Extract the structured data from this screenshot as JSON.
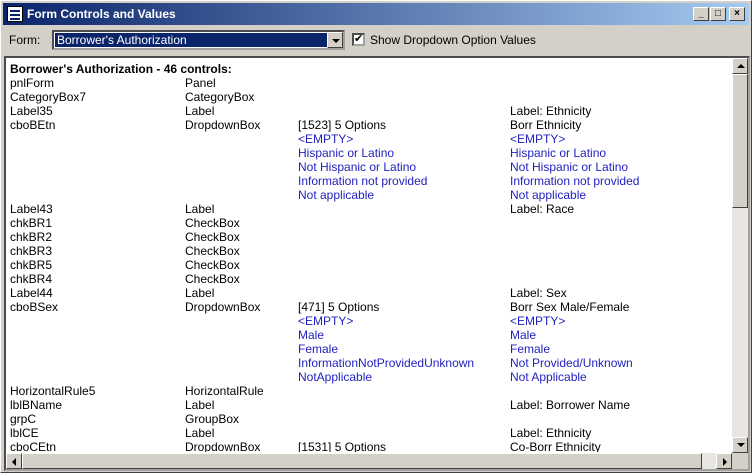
{
  "window": {
    "title": "Form Controls and Values",
    "minimize": "_",
    "maximize": "□",
    "close": "×"
  },
  "form": {
    "label": "Form:",
    "selected": "Borrower's Authorization",
    "show_values_checked": true,
    "show_values_label": "Show Dropdown Option Values"
  },
  "list": {
    "title": "Borrower's Authorization - 46 controls:",
    "rows": [
      {
        "name": "pnlForm",
        "type": "Panel",
        "info": "",
        "label": "",
        "option": false
      },
      {
        "name": "CategoryBox7",
        "type": "CategoryBox",
        "info": "",
        "label": "",
        "option": false
      },
      {
        "name": "Label35",
        "type": "Label",
        "info": "",
        "label": "Label: Ethnicity",
        "option": false
      },
      {
        "name": "cboBEtn",
        "type": "DropdownBox",
        "info": "[1523] 5 Options",
        "label": "Borr Ethnicity",
        "option": false
      },
      {
        "name": "",
        "type": "",
        "info": "<EMPTY>",
        "label": "<EMPTY>",
        "option": true
      },
      {
        "name": "",
        "type": "",
        "info": "Hispanic or Latino",
        "label": "Hispanic or Latino",
        "option": true
      },
      {
        "name": "",
        "type": "",
        "info": "Not Hispanic or Latino",
        "label": "Not Hispanic or Latino",
        "option": true
      },
      {
        "name": "",
        "type": "",
        "info": "Information not provided",
        "label": "Information not provided",
        "option": true
      },
      {
        "name": "",
        "type": "",
        "info": "Not applicable",
        "label": "Not applicable",
        "option": true
      },
      {
        "name": "Label43",
        "type": "Label",
        "info": "",
        "label": "Label: Race",
        "option": false
      },
      {
        "name": "chkBR1",
        "type": "CheckBox",
        "info": "",
        "label": "",
        "option": false
      },
      {
        "name": "chkBR2",
        "type": "CheckBox",
        "info": "",
        "label": "",
        "option": false
      },
      {
        "name": "chkBR3",
        "type": "CheckBox",
        "info": "",
        "label": "",
        "option": false
      },
      {
        "name": "chkBR5",
        "type": "CheckBox",
        "info": "",
        "label": "",
        "option": false
      },
      {
        "name": "chkBR4",
        "type": "CheckBox",
        "info": "",
        "label": "",
        "option": false
      },
      {
        "name": "Label44",
        "type": "Label",
        "info": "",
        "label": "Label: Sex",
        "option": false
      },
      {
        "name": "cboBSex",
        "type": "DropdownBox",
        "info": "[471] 5 Options",
        "label": "Borr Sex Male/Female",
        "option": false
      },
      {
        "name": "",
        "type": "",
        "info": "<EMPTY>",
        "label": "<EMPTY>",
        "option": true
      },
      {
        "name": "",
        "type": "",
        "info": "Male",
        "label": "Male",
        "option": true
      },
      {
        "name": "",
        "type": "",
        "info": "Female",
        "label": "Female",
        "option": true
      },
      {
        "name": "",
        "type": "",
        "info": "InformationNotProvidedUnknown",
        "label": "Not Provided/Unknown",
        "option": true
      },
      {
        "name": "",
        "type": "",
        "info": "NotApplicable",
        "label": "Not Applicable",
        "option": true
      },
      {
        "name": "HorizontalRule5",
        "type": "HorizontalRule",
        "info": "",
        "label": "",
        "option": false
      },
      {
        "name": "lblBName",
        "type": "Label",
        "info": "",
        "label": "Label: Borrower Name",
        "option": false
      },
      {
        "name": "grpC",
        "type": "GroupBox",
        "info": "",
        "label": "",
        "option": false
      },
      {
        "name": "lblCE",
        "type": "Label",
        "info": "",
        "label": "Label: Ethnicity",
        "option": false
      },
      {
        "name": "cboCEtn",
        "type": "DropdownBox",
        "info": "[1531] 5 Options",
        "label": "Co-Borr Ethnicity",
        "option": false
      }
    ]
  }
}
